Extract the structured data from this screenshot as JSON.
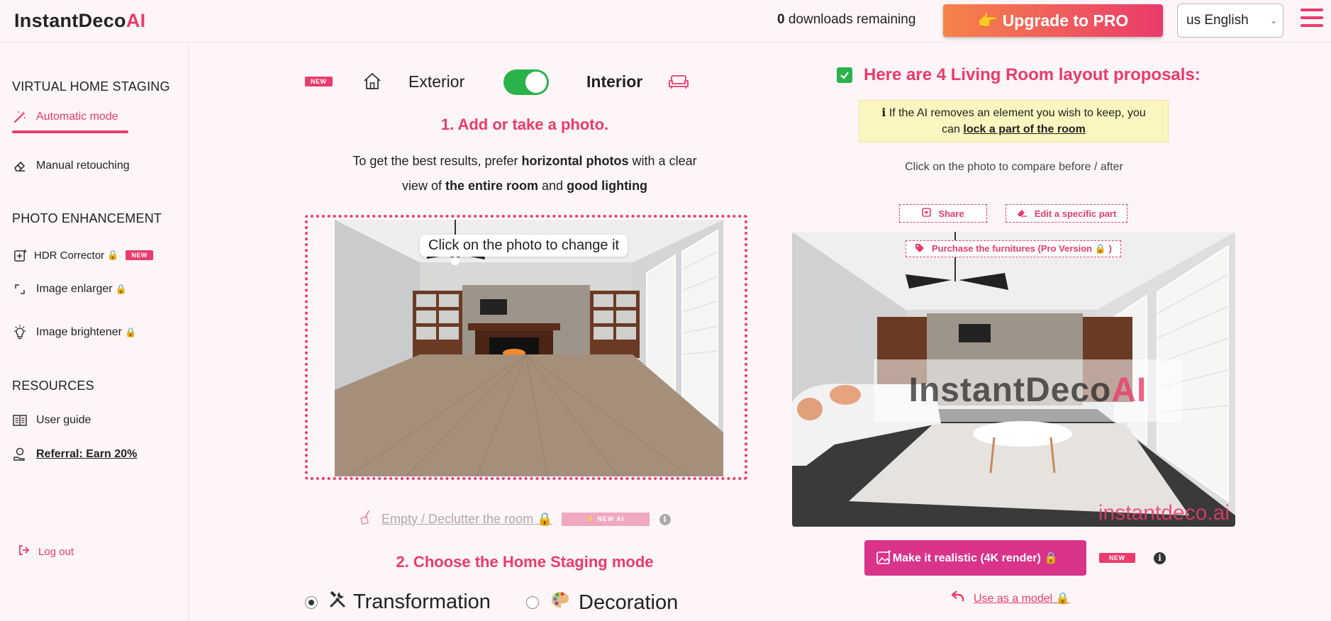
{
  "header": {
    "logo_main": "InstantDeco",
    "logo_ai": "AI",
    "downloads_count": "0",
    "downloads_text": "downloads remaining",
    "upgrade_label": "👉 Upgrade to PRO",
    "language": "us English"
  },
  "sidebar": {
    "section_staging": "VIRTUAL HOME STAGING",
    "automatic_mode": "Automatic mode",
    "manual_retouching": "Manual retouching",
    "section_enhancement": "PHOTO ENHANCEMENT",
    "hdr_corrector": "HDR Corrector",
    "image_enlarger": "Image enlarger",
    "image_brightener": "Image brightener",
    "section_resources": "RESOURCES",
    "user_guide": "User guide",
    "referral": "Referral: Earn 20%",
    "logout": "Log out",
    "new_badge": "NEW",
    "lock": "🔒"
  },
  "main": {
    "new_badge": "NEW",
    "exterior": "Exterior",
    "interior": "Interior",
    "interior_selected": true,
    "step1_title": "1. Add or take a photo.",
    "tips_part1": "To get the best results, prefer",
    "tips_bold1": "horizontal photos",
    "tips_part2": "with a clear",
    "tips_part3": "view of",
    "tips_bold2": "the entire room",
    "tips_part4": "and",
    "tips_bold3": "good lighting",
    "change_photo_tooltip": "Click on the photo to change it",
    "declutter_label": "Empty / Declutter the room 🔒",
    "new_ai_badge": "✨ NEW AI",
    "info_glyph": "i",
    "step2_title": "2. Choose the Home Staging mode",
    "mode_transformation": "Transformation",
    "mode_decoration": "Decoration",
    "selected_mode": "Transformation"
  },
  "results": {
    "title": "Here are 4 Living Room layout proposals:",
    "info_line1": "ℹ  If the AI removes an element you wish to keep, you",
    "info_line2_prefix": "can",
    "info_link": "lock a part of the room",
    "compare_hint": "Click on the photo to compare before / after",
    "share_label": "Share",
    "edit_label": "Edit a specific part",
    "purchase_label": "Purchase the furnitures (Pro Version 🔒 )",
    "watermark_main": "InstantDeco",
    "watermark_ai": "AI",
    "watermark_url": "instantdeco.ai",
    "realistic_label": "Make it realistic (4K render) 🔒",
    "new_badge": "NEW",
    "info_glyph": "i",
    "use_model_label": "Use as a model  🔒"
  },
  "colors": {
    "accent": "#ea3b6c",
    "toggle_on": "#2bb34b",
    "background": "#fdf5f8",
    "info_bg": "#fbf5bf"
  }
}
